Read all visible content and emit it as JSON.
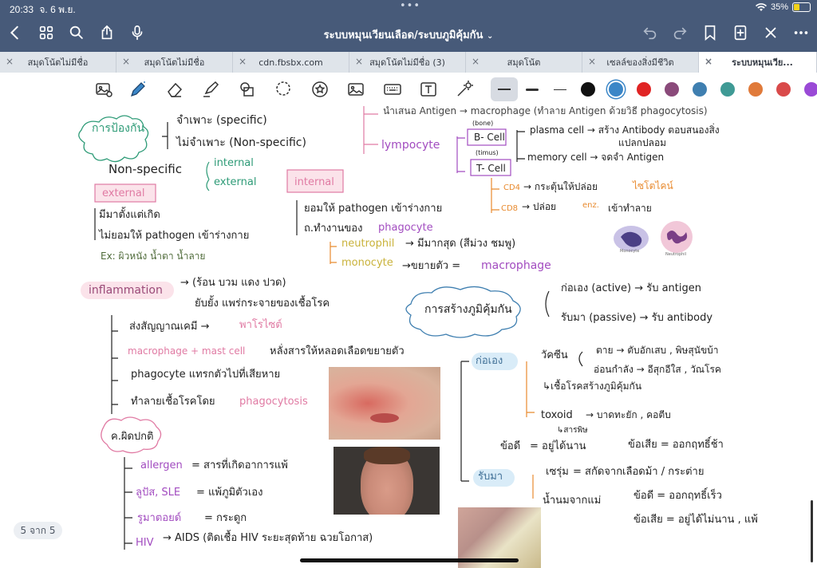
{
  "status": {
    "time": "20:33",
    "date": "จ. 6 พ.ย.",
    "wifi_icon": "wifi-icon",
    "battery": "35%",
    "battery_level": 0.35
  },
  "nav": {
    "title": "ระบบหมุนเวียนเลือด/ระบบภูมิคุ้มกัน",
    "icons": [
      "back-icon",
      "grid-icon",
      "search-icon",
      "share-icon",
      "mic-icon",
      "undo-icon",
      "redo-icon",
      "bookmark-icon",
      "add-page-icon",
      "close-icon",
      "more-icon"
    ]
  },
  "tabs": [
    {
      "label": "สมุดโน้ตไม่มีชื่อ"
    },
    {
      "label": "สมุดโน้ตไม่มีชื่อ"
    },
    {
      "label": "cdn.fbsbx.com"
    },
    {
      "label": "สมุดโน้ตไม่มีชื่อ (3)"
    },
    {
      "label": "สมุดโน้ต"
    },
    {
      "label": "เซลล์ของสิ่งมีชีวิต"
    },
    {
      "label": "ระบบหมุนเวีย..."
    }
  ],
  "toolbar": {
    "tools": [
      "lasso-image-icon",
      "pen-icon",
      "eraser-icon",
      "highlighter-icon",
      "shapes-icon",
      "lasso-icon",
      "sticker-icon",
      "image-icon",
      "keyboard-icon",
      "text-box-icon",
      "laser-icon"
    ],
    "colors": [
      "#111111",
      "#3b86c7",
      "#e02424",
      "#8a4a7a",
      "#3f7fb0",
      "#3f9a95",
      "#e07a3a",
      "#d94a4a"
    ]
  },
  "note": {
    "t1": "การป้องกัน",
    "t2": "จำเพาะ  (specific)",
    "t3": "ไม่จำเพาะ  (Non-specific)",
    "t4": "Non-specific",
    "t5": "internal",
    "t6": "external",
    "t7": "external",
    "t8": "มีมาตั้งแต่เกิด",
    "t9": "ไม่ยอมให้ pathogen  เข้าร่างกาย",
    "t10": "Ex: ผิวหนัง  น้ำตา   น้ำลาย",
    "t11": "internal",
    "t12": "ยอมให้ pathogen  เข้าร่างกาย",
    "t13": "ถ.ทำงานของ",
    "t14": "phagocyte",
    "t15": "neutrophil",
    "t16": "→ มีมากสุด  (สีม่วง ชมพู)",
    "t17": "monocyte",
    "t18": "→ขยายตัว  =",
    "t19": "macrophage",
    "t20": "นำเสนอ Antigen  → macrophage (ทำลาย Antigen ด้วยวิธี phagocytosis)",
    "t21": "lympocyte",
    "t22": "(bone)",
    "t23": "B- Cell",
    "t24": "(timus)",
    "t25": "T- Cell",
    "t26": "plasma  cell  →  สร้าง Antibody  ตอบสนองสิ่ง",
    "t27": "แปลกปลอม",
    "t28": "memory  cell  →  จดจำ  Antigen",
    "t29": "CD4",
    "t30": "→ กระตุ้นให้ปล่อย",
    "t31": "ไซโตไคน์",
    "t32": "CD8",
    "t33": "→  ปล่อย",
    "t34": "enz.",
    "t35": "เข้าทำลาย",
    "t36": "inflammation",
    "t37": "→  (ร้อน  บวม  แดง  ปวด)",
    "t38": "ยับยั้ง  แพร่กระจายของเชื้อโรค",
    "t39": "ส่งสัญญาณเคมี  →",
    "t40": "พาโรไซต์",
    "t41": "macrophage + mast cell",
    "t42": "หลั่งสารให้หลอดเลือดขยายตัว",
    "t43": "phagocyte   แทรกตัวไปที่เสียหาย",
    "t44": "ทำลายเชื้อโรคโดย",
    "t45": "phagocytosis",
    "t46": "ค.ผิดปกติ",
    "t47": "allergen",
    "t48": "=  สารที่เกิดอาการแพ้",
    "t49": "ลูปัส, SLE",
    "t50": "=  แพ้ภูมิตัวเอง",
    "t51": "รูมาตอยด์",
    "t52": "=  กระดูก",
    "t53": "HIV",
    "t54": "→  AIDS  (ติดเชื้อ  HIV  ระยะสุดท้าย  ฉวยโอกาส)",
    "t55": "การสร้างภูมิคุ้มกัน",
    "t56": "ก่อเอง  (active)  →  รับ  antigen",
    "t57": "รับมา  (passive)  →  รับ  antibody",
    "t58": "ก่อเอง",
    "t59": "วัคซีน",
    "t60": "ตาย     →  ตับอักเสบ , พิษสุนัขบ้า",
    "t61": "อ่อนกำลัง  →  อีสุกอีใส , วัณโรค",
    "t62": "↳เชื้อโรคสร้างภูมิคุ้มกัน",
    "t63": "toxoid",
    "t64": "→  บาดทะยัก , คอตีบ",
    "t65": "↳สารพิษ",
    "t66": "ข้อดี",
    "t67": "=  อยู่ได้นาน",
    "t68": "ข้อเสีย  =  ออกฤทธิ์ช้า",
    "t69": "รับมา",
    "t70": "เซรุ่ม",
    "t71": "=  สกัดจากเลือดม้า / กระต่าย",
    "t72": "น้ำนมจากแม่",
    "t73": "ข้อดี  =  ออกฤทธิ์เร็ว",
    "t74": "ข้อเสีย  =  อยู่ได้ไม่นาน , แพ้",
    "monocyte_label": "Monocyte",
    "neutrophil_label": "Neutrophil",
    "page": "5 จาก 5"
  }
}
